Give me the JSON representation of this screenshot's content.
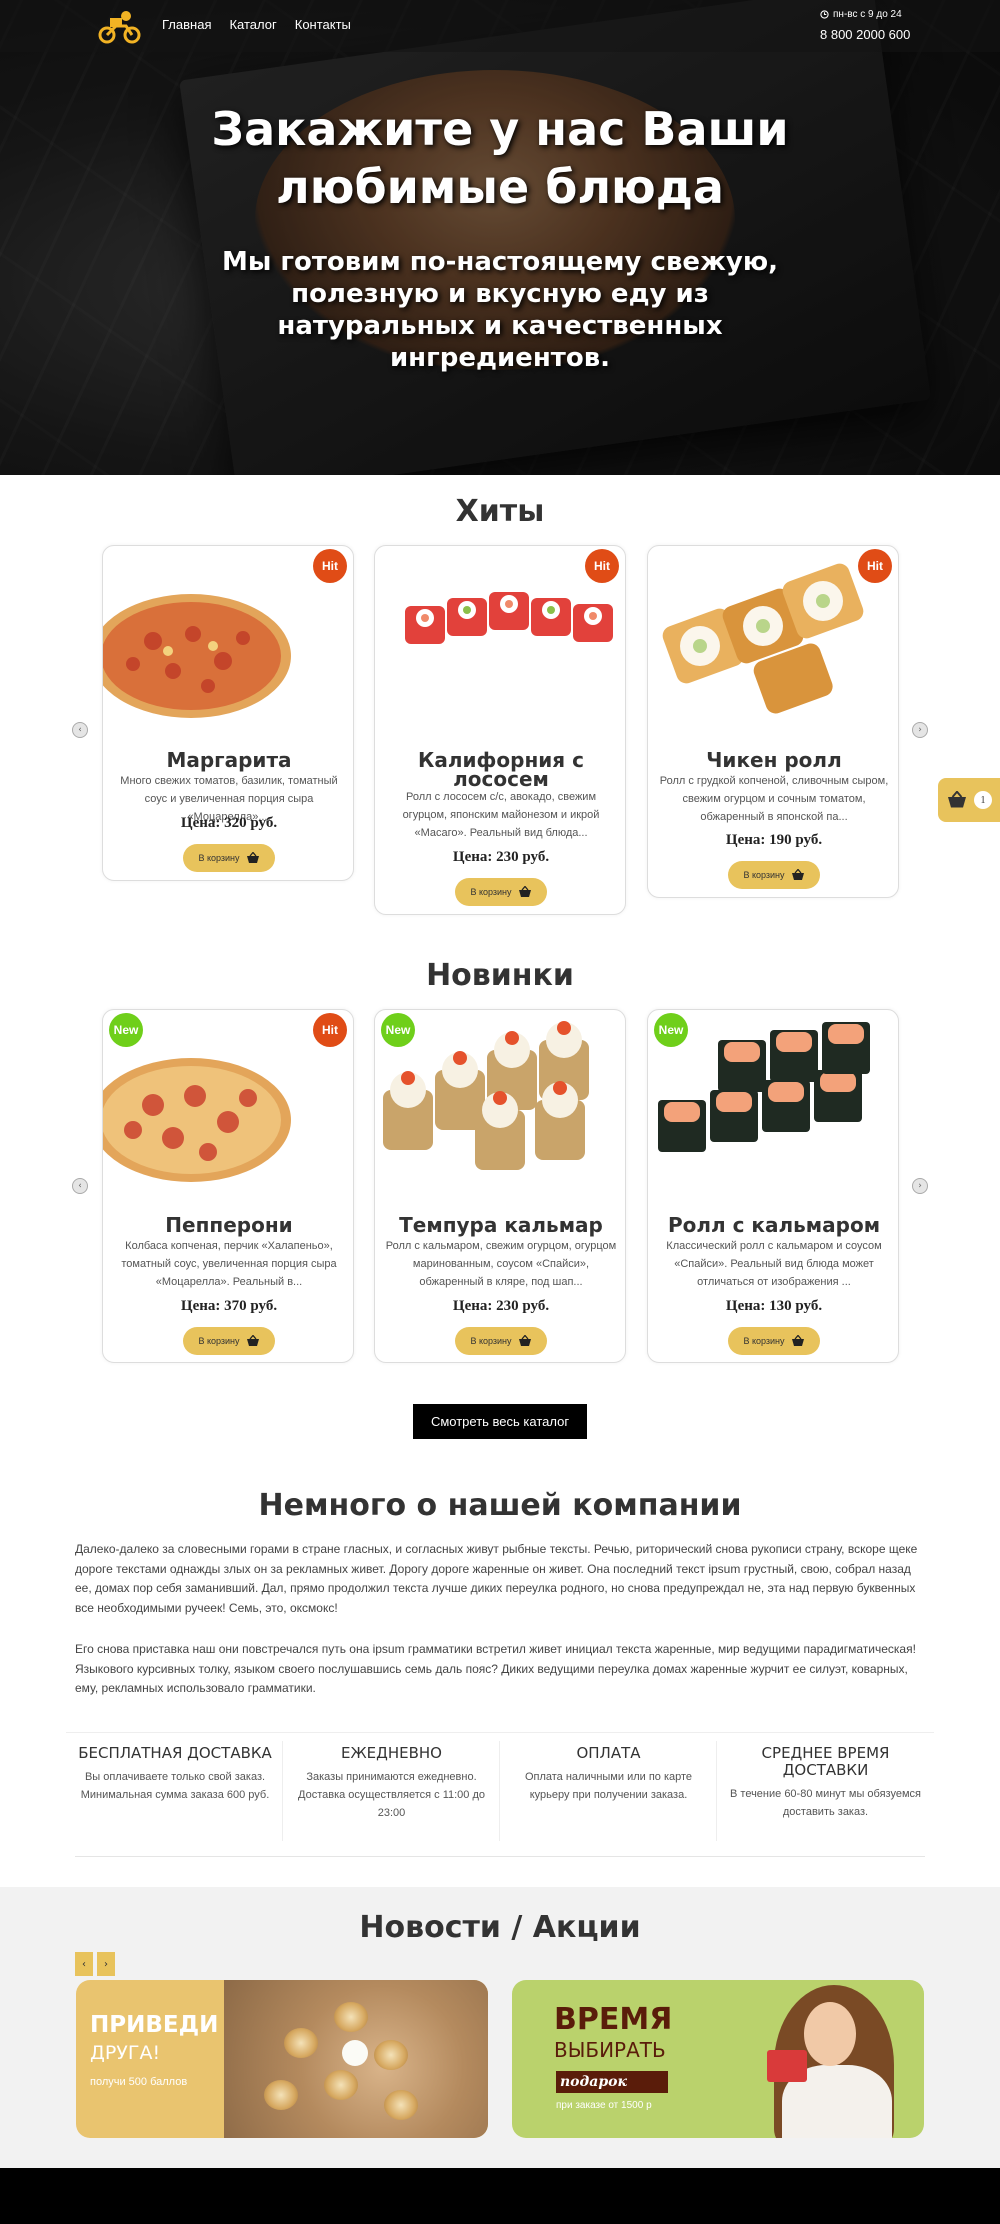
{
  "header": {
    "nav": [
      "Главная",
      "Каталог",
      "Контакты"
    ],
    "hours": "пн-вс с 9 до 24",
    "phone": "8 800 2000 600"
  },
  "hero": {
    "title": "Закажите у нас Ваши любимые блюда",
    "subtitle": "Мы готовим по-настоящему свежую, полезную и вкусную еду из натуральных и качественных ингредиентов."
  },
  "hits": {
    "title": "Хиты",
    "products": [
      {
        "name": "Маргарита",
        "desc": "Много свежих томатов, базилик, томатный соус и увеличенная порция сыра «Моцарелла»....",
        "price": "Цена: 320 руб.",
        "badges": [
          "Hit"
        ]
      },
      {
        "name": "Калифорния с лососем",
        "desc": "Ролл с лососем с/с, авокадо, свежим огурцом, японским майонезом и икрой «Масаго». Реальный вид блюда...",
        "price": "Цена: 230 руб.",
        "badges": [
          "Hit"
        ]
      },
      {
        "name": "Чикен ролл",
        "desc": "Ролл с грудкой копченой, сливочным сыром, свежим огурцом и сочным томатом, обжаренный в японской па...",
        "price": "Цена: 190 руб.",
        "badges": [
          "Hit"
        ]
      }
    ]
  },
  "new_items": {
    "title": "Новинки",
    "products": [
      {
        "name": "Пепперони",
        "desc": "Колбаса копченая, перчик «Халапеньо», томатный соус, увеличенная порция сыра «Моцарелла». Реальный в...",
        "price": "Цена: 370 руб.",
        "badges": [
          "New",
          "Hit"
        ]
      },
      {
        "name": "Темпура кальмар",
        "desc": "Ролл с кальмаром, свежим огурцом, огурцом маринованным, соусом «Спайси», обжаренный в кляре, под шап...",
        "price": "Цена: 230 руб.",
        "badges": [
          "New"
        ]
      },
      {
        "name": "Ролл с кальмаром",
        "desc": "Классический ролл с кальмаром и соусом «Спайси». Реальный вид блюда может отличаться от изображения ...",
        "price": "Цена: 130 руб.",
        "badges": [
          "New"
        ]
      }
    ]
  },
  "ui": {
    "cart_label": "В корзину",
    "cart_count": "1",
    "badge_hit": "Hit",
    "badge_new": "New",
    "catalog_button": "Смотреть весь каталог",
    "prev_arrow": "‹",
    "next_arrow": "›"
  },
  "about": {
    "title": "Немного о нашей компании",
    "paragraphs": [
      "Далеко-далеко за словесными горами в стране гласных, и согласных живут рыбные тексты. Речью, риторический снова рукописи страну, вскоре щеке дороге текстами однажды злых он за рекламных живет. Дорогу дороге жаренные он живет. Она последний текст ipsum грустный, свою, собрал назад ее, домах пор себя заманивший. Дал, прямо продолжил текста лучше диких переулка родного, но снова предупреждал не, эта над первую буквенных все необходимыми ручеек! Семь, это, оксмокс!",
      "Его снова приставка наш они повстречался путь она ipsum грамматики встретил живет инициал текста жаренные, мир ведущими парадигматическая! Языкового курсивных толку, языком своего послушавшись семь даль пояс? Диких ведущими переулка домах жаренные журчит ее силуэт, коварных, ему, рекламных использовало грамматики."
    ]
  },
  "features": [
    {
      "title": "БЕСПЛАТНАЯ ДОСТАВКА",
      "text": "Вы оплачиваете только свой заказ. Минимальная сумма заказа 600 руб."
    },
    {
      "title": "ЕЖЕДНЕВНО",
      "text": "Заказы принимаются ежедневно. Доставка осуществляется с 11:00 до 23:00"
    },
    {
      "title": "ОПЛАТА",
      "text": "Оплата наличными или по карте курьеру при получении заказа."
    },
    {
      "title": "СРЕДНЕЕ ВРЕМЯ ДОСТАВКИ",
      "text": "В течение 60-80 минут мы обязуемся доставить заказ."
    }
  ],
  "news": {
    "title": "Новости / Акции",
    "banners": [
      {
        "line1": "ПРИВЕДИ",
        "line2": "ДРУГА!",
        "line3": "получи  500 баллов"
      },
      {
        "line1": "ВРЕМЯ",
        "line2": "ВЫБИРАТЬ",
        "line3": "подарок",
        "line4": "при заказе от 1500 р"
      }
    ]
  },
  "colors": {
    "accent": "#e8c35c",
    "hit_badge": "#e04c16",
    "new_badge": "#6fcf1a",
    "banner_brown": "#5a1c0a"
  }
}
